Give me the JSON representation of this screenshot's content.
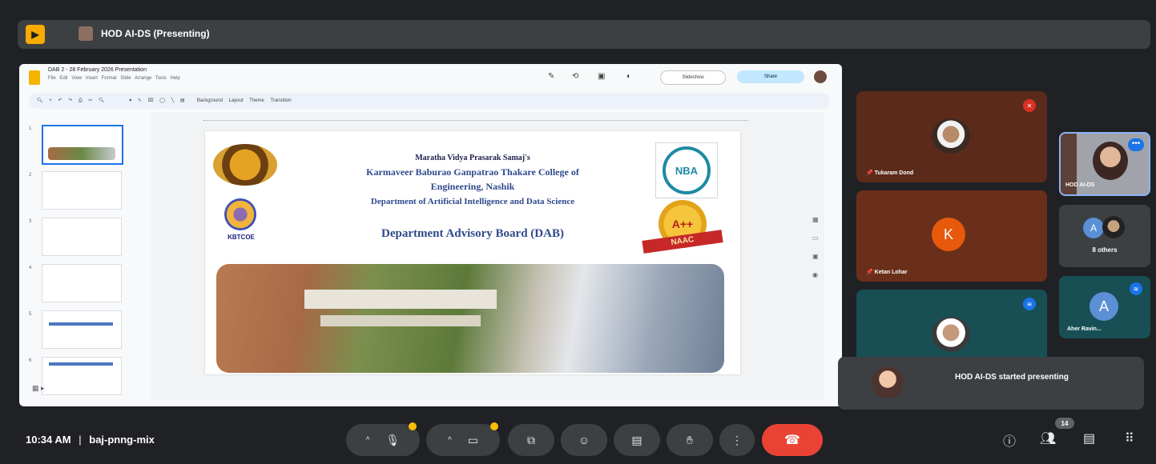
{
  "top_bar": {
    "presenting_title": "HOD AI-DS (Presenting)"
  },
  "slides_app": {
    "doc_title": "DAB 2 - 28 February 2026 Presentation",
    "menu": "File Edit View Insert Format Slide Arrange Tools Help",
    "slideshow_label": "Slideshow",
    "share_label": "Share",
    "toolbar": "Background  Layout  Theme  Transition",
    "thumb_numbers": [
      "1",
      "2",
      "3",
      "4",
      "5",
      "6"
    ]
  },
  "slide": {
    "line1": "Maratha Vidya Prasarak Samaj's",
    "line2": "Karmaveer Baburao Ganpatrao Thakare College of",
    "line3": "Engineering, Nashik",
    "line4": "Department of Artificial Intelligence and Data Science",
    "heading": "Department Advisory Board (DAB)",
    "kbtcoe_label": "KBTCOE",
    "nba_label": "NBA",
    "naac_grade": "A++",
    "naac_label": "NAAC"
  },
  "participants": {
    "tukaram": {
      "name": "Tukaram Dond"
    },
    "ketan": {
      "name": "Ketan Lohar",
      "initial": "K"
    },
    "hod": {
      "name": "HOD AI-DS"
    },
    "others": {
      "label": "8 others",
      "initial": "A"
    },
    "aher": {
      "name": "Aher Ravin...",
      "initial": "A"
    }
  },
  "toast": {
    "message": "HOD AI-DS started presenting"
  },
  "bottom_bar": {
    "time": "10:34 AM",
    "separator": "|",
    "meeting_code": "baj-pnng-mix",
    "participant_count": "14"
  },
  "colors": {
    "leave": "#ea4335",
    "tile_warm": "#5b2a1a",
    "tile_teal": "#174f55",
    "accent": "#1a73e8"
  }
}
